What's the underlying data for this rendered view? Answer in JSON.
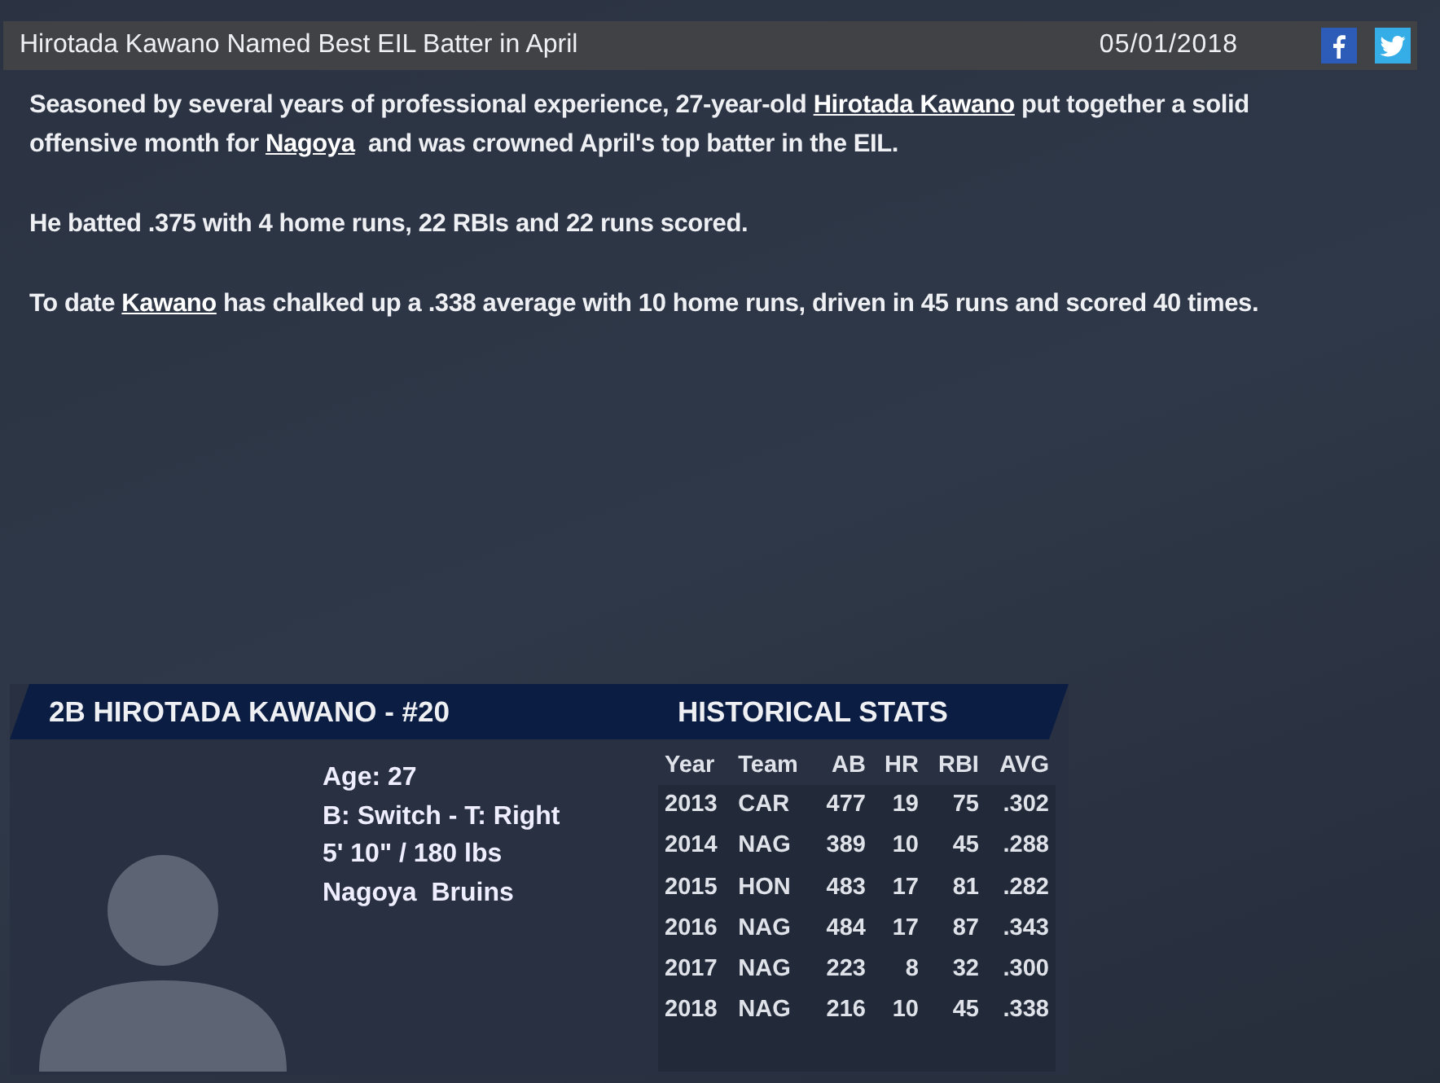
{
  "article": {
    "headline": "Hirotada Kawano Named Best EIL Batter in April",
    "date": "05/01/2018",
    "share": [
      {
        "kind": "facebook"
      },
      {
        "kind": "twitter"
      }
    ],
    "paragraphs": [
      [
        {
          "text": "Seasoned by several years of professional experience, 27-year-old "
        },
        {
          "link": "Hirotada Kawano"
        },
        {
          "text": " put together a solid offensive month for "
        },
        {
          "link": "Nagoya"
        },
        {
          "text": "  and was crowned April's top batter in the EIL."
        }
      ],
      [
        {
          "text": "He batted .375 with 4 home runs, 22 RBIs and 22 runs scored."
        }
      ],
      [
        {
          "text": "To date "
        },
        {
          "link": "Kawano"
        },
        {
          "text": " has chalked up a .338 average with 10 home runs, driven in 45 runs and scored 40 times."
        }
      ]
    ]
  },
  "player_card": {
    "banner": "2B HIROTADA KAWANO - #20",
    "stats_title": "HISTORICAL STATS",
    "info": [
      "Age: 27",
      "B: Switch - T: Right",
      "5' 10\" / 180 lbs",
      "Nagoya  Bruins"
    ],
    "columns": [
      "Year",
      "Team",
      "AB",
      "HR",
      "RBI",
      "AVG"
    ],
    "rows": [
      [
        "2013",
        "CAR",
        "477",
        "19",
        "75",
        ".302"
      ],
      [
        "2014",
        "NAG",
        "389",
        "10",
        "45",
        ".288"
      ],
      [
        "2015",
        "HON",
        "483",
        "17",
        "81",
        ".282"
      ],
      [
        "2016",
        "NAG",
        "484",
        "17",
        "87",
        ".343"
      ],
      [
        "2017",
        "NAG",
        "223",
        "8",
        "32",
        ".300"
      ],
      [
        "2018",
        "NAG",
        "216",
        "10",
        "45",
        ".338"
      ]
    ]
  }
}
